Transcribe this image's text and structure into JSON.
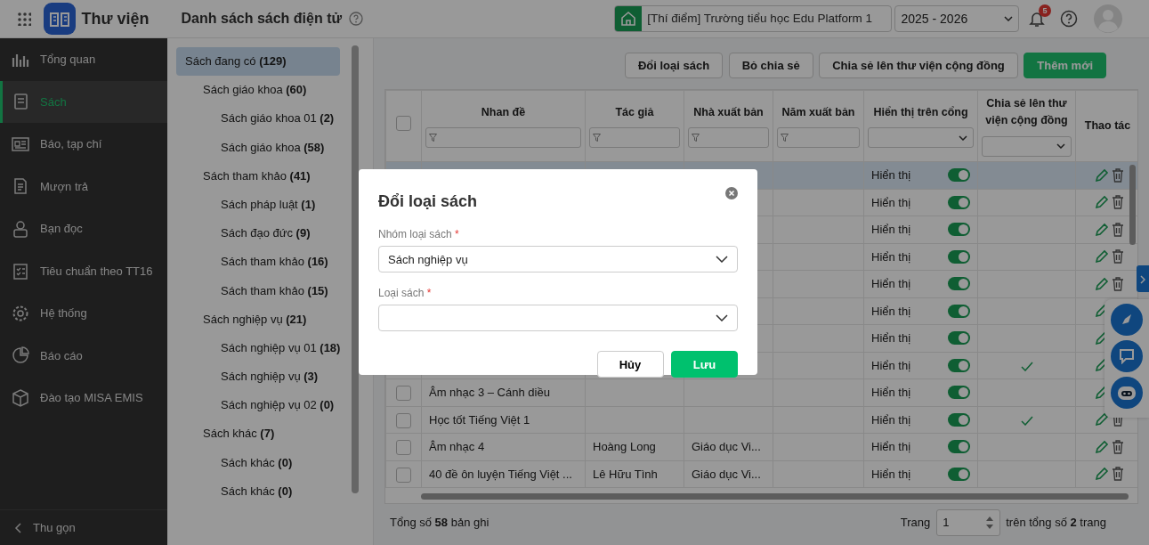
{
  "header": {
    "app_title": "Thư viện",
    "page_title": "Danh sách sách điện tử",
    "school": "[Thí điểm] Trường tiểu học Edu Platform 1",
    "school_year": "2025 - 2026",
    "notification_count": "5"
  },
  "sidebar": {
    "items": [
      {
        "label": "Tổng quan",
        "selected": false
      },
      {
        "label": "Sách",
        "selected": true
      },
      {
        "label": "Báo, tạp chí",
        "selected": false
      },
      {
        "label": "Mượn trả",
        "selected": false
      },
      {
        "label": "Bạn đọc",
        "selected": false
      },
      {
        "label": "Tiêu chuẩn theo TT16",
        "selected": false
      },
      {
        "label": "Hệ thống",
        "selected": false
      },
      {
        "label": "Báo cáo",
        "selected": false
      },
      {
        "label": "Đào tạo MISA EMIS",
        "selected": false
      }
    ],
    "collapse_label": "Thu gọn"
  },
  "category_tree": [
    {
      "label": "Sách đang có **(129)**",
      "selected": true,
      "children": [
        {
          "label": "Sách giáo khoa **(60)**",
          "selected": false,
          "children": [
            {
              "label": "Sách giáo khoa 01 **(2)**",
              "selected": false
            },
            {
              "label": "Sách giáo khoa **(58)**",
              "selected": false
            }
          ]
        },
        {
          "label": "Sách tham khảo **(41)**",
          "selected": false,
          "children": [
            {
              "label": "Sách pháp luật **(1)**",
              "selected": false
            },
            {
              "label": "Sách đạo đức **(9)**",
              "selected": false
            },
            {
              "label": "Sách tham khảo **(16)**",
              "selected": false
            },
            {
              "label": "Sách tham khảo **(15)**",
              "selected": false
            }
          ]
        },
        {
          "label": "Sách nghiệp vụ **(21)**",
          "selected": false,
          "children": [
            {
              "label": "Sách nghiệp vụ 01 **(18)**",
              "selected": false
            },
            {
              "label": "Sách nghiệp vụ **(3)**",
              "selected": false
            },
            {
              "label": "Sách nghiệp vụ 02 **(0)**",
              "selected": false
            }
          ]
        },
        {
          "label": "Sách khác **(7)**",
          "selected": false,
          "children": [
            {
              "label": "Sách khác **(0)**",
              "selected": false
            },
            {
              "label": "Sách khác **(0)**",
              "selected": false
            }
          ]
        }
      ]
    }
  ],
  "toolbar": {
    "buttons": [
      {
        "label": "Đổi loại sách",
        "kind": "outline"
      },
      {
        "label": "Bỏ chia sẻ",
        "kind": "outline"
      },
      {
        "label": "Chia sẻ lên thư viện cộng đồng",
        "kind": "outline"
      },
      {
        "label": "Thêm mới",
        "kind": "primary"
      }
    ]
  },
  "table": {
    "select_all_checked": false,
    "columns": [
      {
        "label": "Nhan đề",
        "kind": "textfilter"
      },
      {
        "label": "Tác giả",
        "kind": "textfilter"
      },
      {
        "label": "Nhà xuất bản",
        "kind": "textfilter"
      },
      {
        "label": "Năm xuất bản",
        "kind": "textfilter"
      },
      {
        "label": "Hiển thị trên cổng",
        "kind": "selectfilter"
      },
      {
        "label": "Chia sẻ lên thư viện cộng đồng",
        "kind": "selectfilter"
      },
      {
        "label": "Thao tác",
        "kind": "plain"
      }
    ],
    "rows": [
      {
        "selected": true,
        "display": "Hiển thị",
        "display_on": true,
        "shared": false,
        "actions": [
          {
            "kind": "edit"
          },
          {
            "kind": "delete"
          }
        ]
      },
      {
        "selected": false,
        "display": "Hiển thị",
        "display_on": true,
        "shared": false,
        "actions": [
          {
            "kind": "edit"
          },
          {
            "kind": "delete"
          }
        ]
      },
      {
        "selected": false,
        "display": "Hiển thị",
        "display_on": true,
        "shared": false,
        "actions": [
          {
            "kind": "edit"
          },
          {
            "kind": "delete"
          }
        ]
      },
      {
        "selected": false,
        "display": "Hiển thị",
        "display_on": true,
        "shared": false,
        "actions": [
          {
            "kind": "edit"
          },
          {
            "kind": "delete"
          }
        ]
      },
      {
        "selected": false,
        "display": "Hiển thị",
        "display_on": true,
        "shared": false,
        "actions": [
          {
            "kind": "edit"
          },
          {
            "kind": "delete"
          }
        ]
      },
      {
        "selected": false,
        "display": "Hiển thị",
        "display_on": true,
        "shared": false,
        "actions": [
          {
            "kind": "edit"
          }
        ]
      },
      {
        "selected": false,
        "display": "Hiển thị",
        "display_on": true,
        "shared": false,
        "actions": [
          {
            "kind": "edit"
          }
        ]
      },
      {
        "selected": false,
        "display": "Hiển thị",
        "display_on": true,
        "shared": true,
        "actions": [
          {
            "kind": "edit"
          }
        ]
      },
      {
        "selected": false,
        "checked": false,
        "title": "Âm nhạc 3 – Cánh diều",
        "display": "Hiển thị",
        "display_on": true,
        "shared": false,
        "actions": [
          {
            "kind": "edit"
          }
        ]
      },
      {
        "selected": false,
        "checked": false,
        "title": "Học tốt Tiếng Việt 1",
        "display": "Hiển thị",
        "display_on": true,
        "shared": true,
        "actions": [
          {
            "kind": "edit"
          },
          {
            "kind": "delete"
          }
        ]
      },
      {
        "selected": false,
        "checked": false,
        "title": "Âm nhạc 4",
        "author": "Hoàng Long",
        "publisher": "Giáo dục Vi...",
        "display": "Hiển thị",
        "display_on": true,
        "shared": false,
        "actions": [
          {
            "kind": "edit"
          },
          {
            "kind": "delete"
          }
        ]
      },
      {
        "selected": false,
        "checked": false,
        "title": "40 đề ôn luyện Tiếng Việt ...",
        "author": "Lê Hữu Tình",
        "publisher": "Giáo dục Vi...",
        "display": "Hiển thị",
        "display_on": true,
        "shared": false,
        "actions": [
          {
            "kind": "edit"
          },
          {
            "kind": "delete"
          }
        ]
      }
    ]
  },
  "pagination": {
    "total": "Tổng số **58** bản ghi",
    "page_label": "Trang",
    "page": "1",
    "page_total": "trên tổng số **2** trang"
  },
  "dialog": {
    "title": "Đổi loại sách",
    "fields": [
      {
        "label": "Nhóm loại sách",
        "required_mark": "*",
        "value": "Sách nghiệp vụ"
      },
      {
        "label": "Loại sách",
        "required_mark": "*"
      }
    ],
    "buttons": [
      {
        "label": "Hủy",
        "kind": "outline"
      },
      {
        "label": "Lưu",
        "kind": "primary"
      }
    ]
  }
}
